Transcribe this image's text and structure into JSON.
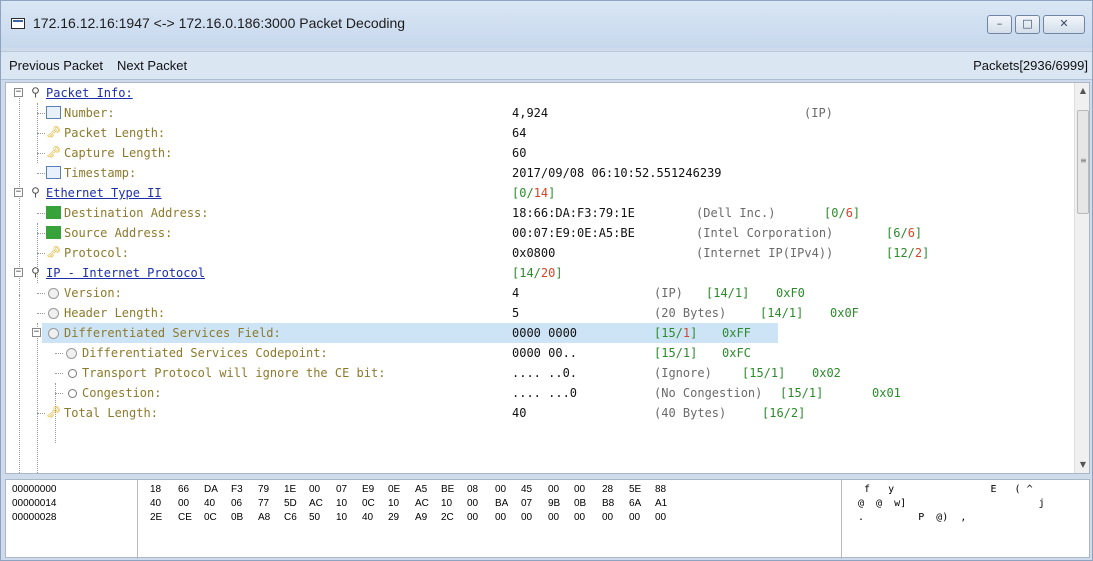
{
  "window": {
    "title": "172.16.12.16:1947 <-> 172.16.0.186:3000 Packet Decoding",
    "min_glyph": "–",
    "max_glyph": "□",
    "close_glyph": "✕"
  },
  "toolbar": {
    "previous": "Previous Packet",
    "next": "Next Packet",
    "packet_count": "Packets[2936/6999]"
  },
  "tree": {
    "packet_info": {
      "label": "Packet Info:",
      "number_label": "Number:",
      "number_value": "4,924",
      "number_note": "(IP)",
      "length_label": "Packet Length:",
      "length_value": "64",
      "capture_label": "Capture Length:",
      "capture_value": "60",
      "timestamp_label": "Timestamp:",
      "timestamp_value": "2017/09/08 06:10:52.551246239"
    },
    "ethernet": {
      "label": "Ethernet Type II",
      "range_a": "[0/",
      "range_b": "14",
      "range_c": "]",
      "dst_label": "Destination Address:",
      "dst_value": "18:66:DA:F3:79:1E",
      "dst_note": "(Dell Inc.)",
      "dst_range_a": "[0/",
      "dst_range_b": "6",
      "dst_range_c": "]",
      "src_label": "Source Address:",
      "src_value": "00:07:E9:0E:A5:BE",
      "src_note": "(Intel Corporation)",
      "src_range_a": "[6/",
      "src_range_b": "6",
      "src_range_c": "]",
      "proto_label": "Protocol:",
      "proto_value": "0x0800",
      "proto_note": "(Internet IP(IPv4))",
      "proto_range_a": "[12/",
      "proto_range_b": "2",
      "proto_range_c": "]"
    },
    "ip": {
      "label": "IP - Internet Protocol",
      "range_a": "[14/",
      "range_b": "20",
      "range_c": "]",
      "version_label": "Version:",
      "version_value": "4",
      "version_note": "(IP)",
      "version_range": "[14/1]",
      "version_mask": "0xF0",
      "hlen_label": "Header Length:",
      "hlen_value": "5",
      "hlen_note": "(20 Bytes)",
      "hlen_range": "[14/1]",
      "hlen_mask": "0x0F",
      "dsf_label": "Differentiated Services Field:",
      "dsf_value": "0000 0000",
      "dsf_range_a": "[15/",
      "dsf_range_b": "1",
      "dsf_range_c": "]",
      "dsf_mask": "0xFF",
      "dscp_label": "Differentiated Services Codepoint:",
      "dscp_value": "0000 00..",
      "dscp_range": "[15/1]",
      "dscp_mask": "0xFC",
      "ce_label": "Transport Protocol will ignore the CE bit:",
      "ce_value": ".... ..0.",
      "ce_note": "(Ignore)",
      "ce_range": "[15/1]",
      "ce_mask": "0x02",
      "cong_label": "Congestion:",
      "cong_value": ".... ...0",
      "cong_note": "(No Congestion)",
      "cong_range": "[15/1]",
      "cong_mask": "0x01",
      "total_label": "Total Length:",
      "total_value": "40",
      "total_note": "(40 Bytes)",
      "total_range": "[16/2]"
    }
  },
  "hex": {
    "rows": [
      {
        "offset": "00000000",
        "bytes": [
          "18",
          "66",
          "DA",
          "F3",
          "79",
          "1E",
          "00",
          "07",
          "E9",
          "0E",
          "A5",
          "BE",
          "08",
          "00",
          "45",
          "00",
          "00",
          "28",
          "5E",
          "88"
        ],
        "ascii": " f   y                E   ( ^"
      },
      {
        "offset": "00000014",
        "bytes": [
          "40",
          "00",
          "40",
          "06",
          "77",
          "5D",
          "AC",
          "10",
          "0C",
          "10",
          "AC",
          "10",
          "00",
          "BA",
          "07",
          "9B",
          "0B",
          "B8",
          "6A",
          "A1"
        ],
        "ascii": "@  @  w]                      j"
      },
      {
        "offset": "00000028",
        "bytes": [
          "2E",
          "CE",
          "0C",
          "0B",
          "A8",
          "C6",
          "50",
          "10",
          "40",
          "29",
          "A9",
          "2C",
          "00",
          "00",
          "00",
          "00",
          "00",
          "00",
          "00",
          "00"
        ],
        "ascii": ".         P  @)  ,"
      }
    ]
  }
}
